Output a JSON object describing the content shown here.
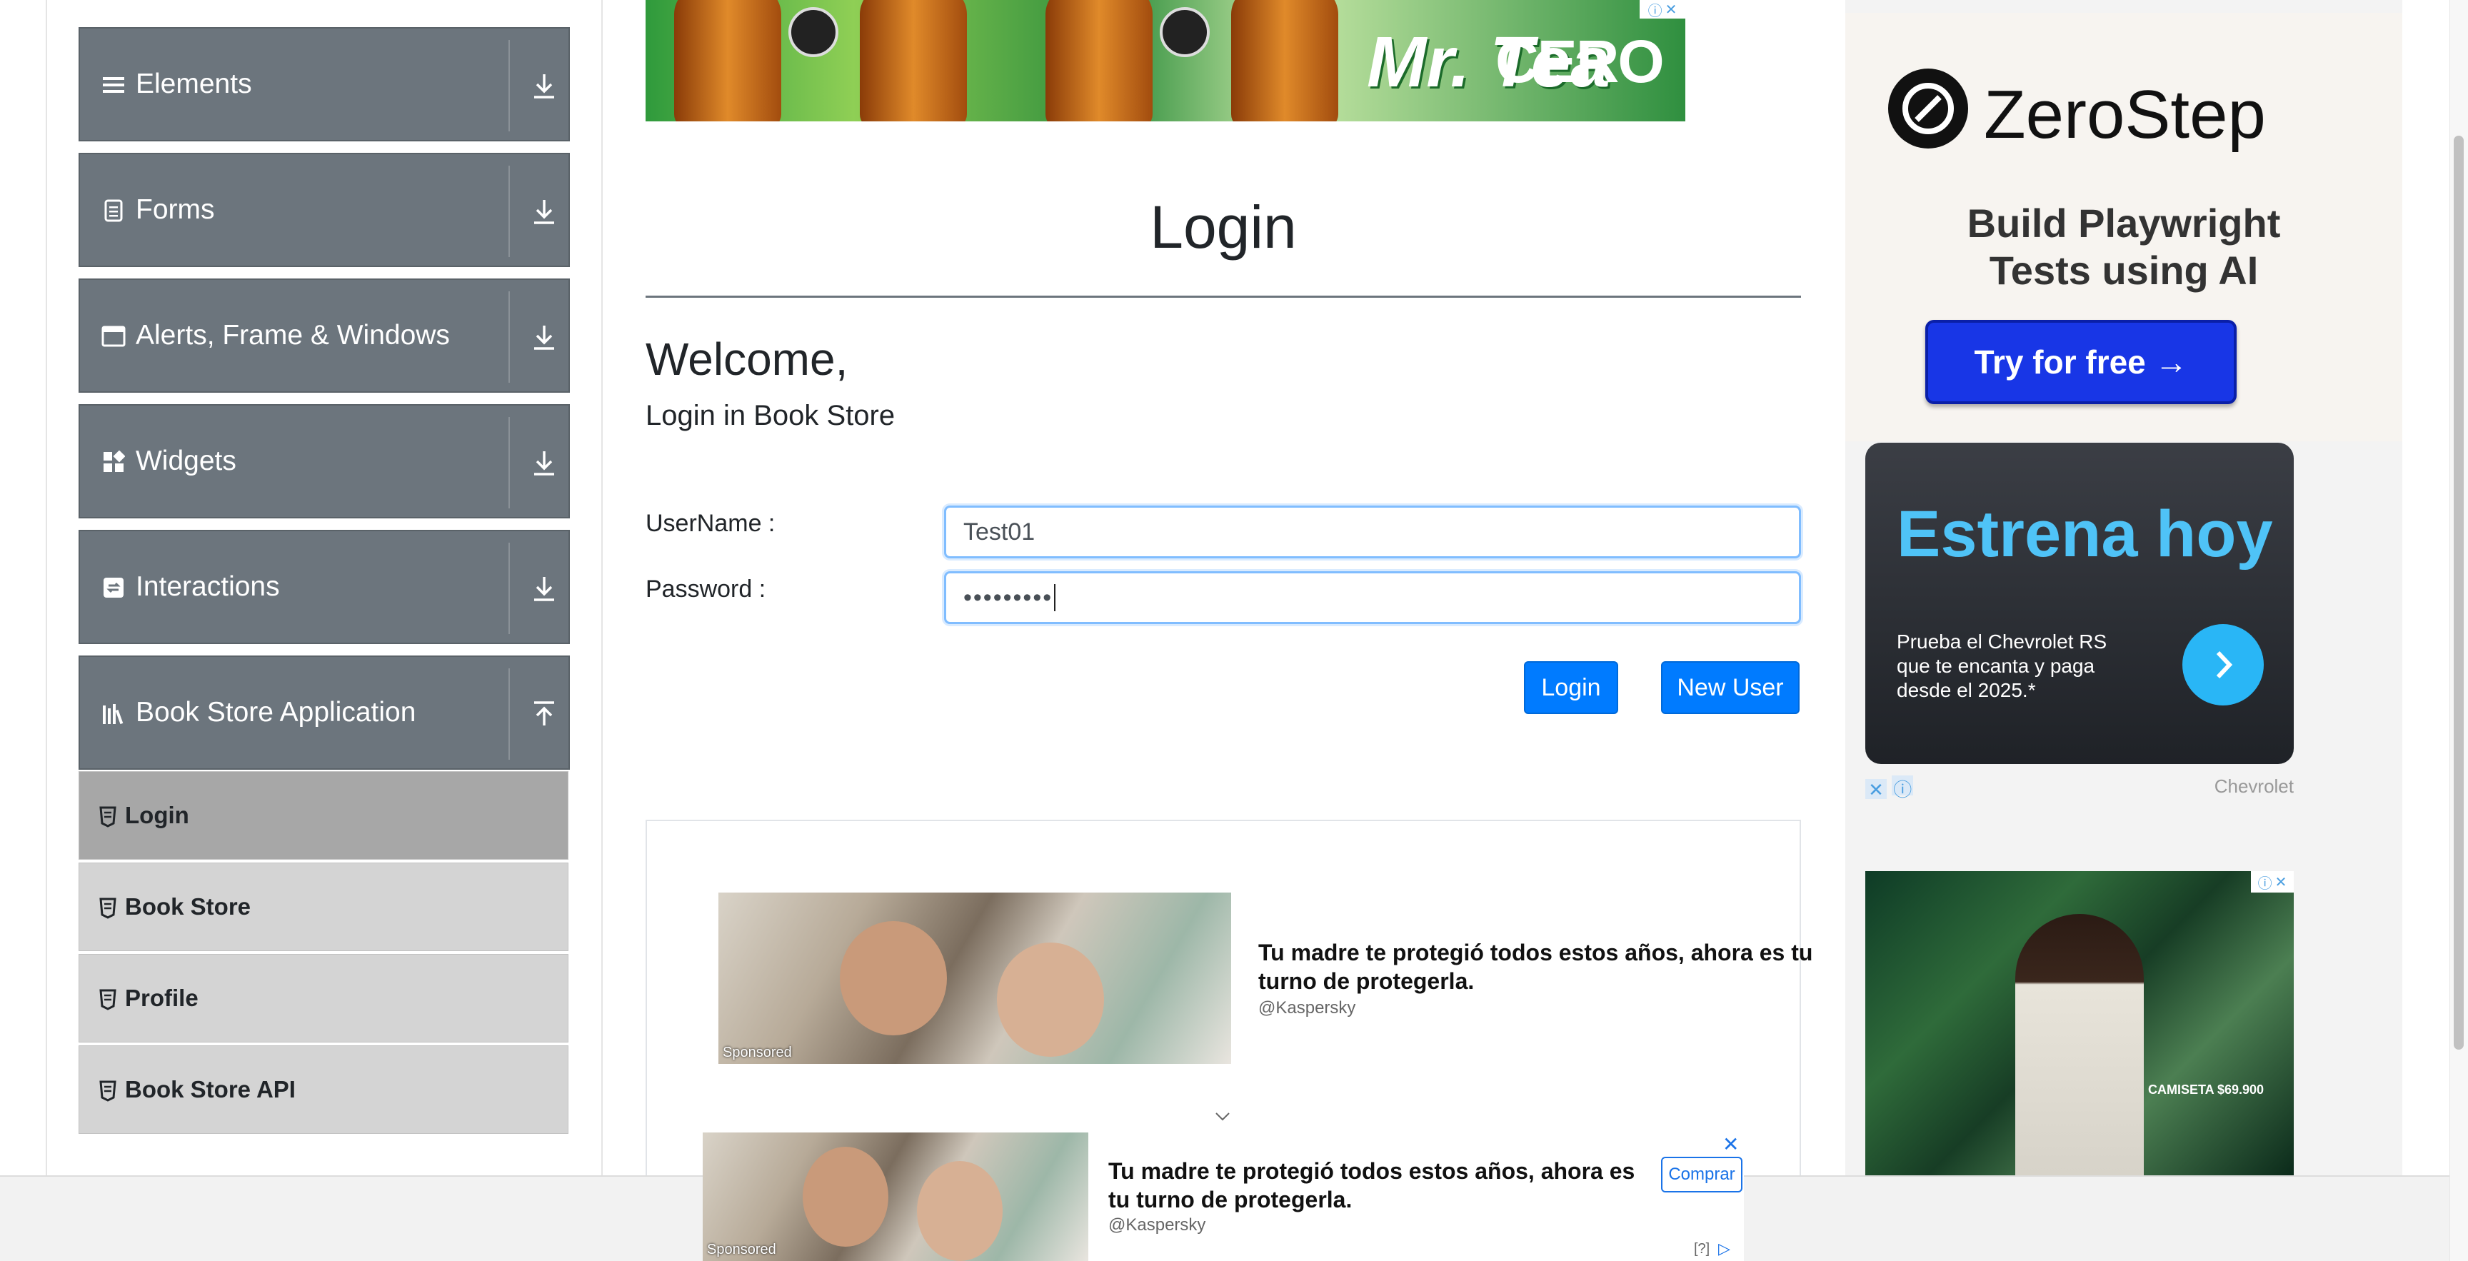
{
  "sidebar": {
    "groups": [
      {
        "label": "Elements",
        "icon": "list-icon",
        "arrow": "download-arrow-icon"
      },
      {
        "label": "Forms",
        "icon": "document-icon",
        "arrow": "download-arrow-icon"
      },
      {
        "label": "Alerts, Frame & Windows",
        "icon": "window-icon",
        "arrow": "download-arrow-icon"
      },
      {
        "label": "Widgets",
        "icon": "widgets-icon",
        "arrow": "download-arrow-icon"
      },
      {
        "label": "Interactions",
        "icon": "interaction-icon",
        "arrow": "download-arrow-icon"
      },
      {
        "label": "Book Store Application",
        "icon": "books-icon",
        "arrow": "upload-arrow-icon"
      }
    ],
    "items": [
      {
        "label": "Login",
        "active": true
      },
      {
        "label": "Book Store",
        "active": false
      },
      {
        "label": "Profile",
        "active": false
      },
      {
        "label": "Book Store API",
        "active": false
      }
    ]
  },
  "top_ad": {
    "brand": "Mr. Tea",
    "suffix": "CERO"
  },
  "main": {
    "title": "Login",
    "welcome": "Welcome,",
    "subtitle": "Login in Book Store",
    "username_label": "UserName :",
    "password_label": "Password :",
    "username_value": "Test01",
    "password_value": "•••••••••",
    "login_button": "Login",
    "new_user_button": "New User"
  },
  "inline_ad": {
    "text": "Tu madre te protegió todos estos años, ahora es tu turno de protegerla.",
    "source": "@Kaspersky",
    "sponsored": "Sponsored"
  },
  "bottom_ad": {
    "text": "Tu madre te protegió todos estos años, ahora es tu turno de protegerla.",
    "source": "@Kaspersky",
    "sponsored": "Sponsored",
    "buy": "Comprar",
    "help": "[?]"
  },
  "right_ads": {
    "zerostep_name": "ZeroStep",
    "zerostep_tagline": "Build Playwright Tests using AI",
    "zerostep_cta": "Try for free →",
    "chevy_heading": "Estrena hoy",
    "chevy_text": "Prueba el Chevrolet RS que te encanta y paga desde el 2025.*",
    "chevy_brand": "Chevrolet",
    "fashion_caption": "CAMISETA $69.900"
  },
  "colors": {
    "primary": "#007bff",
    "sidebar_group": "#6c757d",
    "sidebar_item": "#d4d4d4",
    "sidebar_active": "#a7a7a7"
  }
}
